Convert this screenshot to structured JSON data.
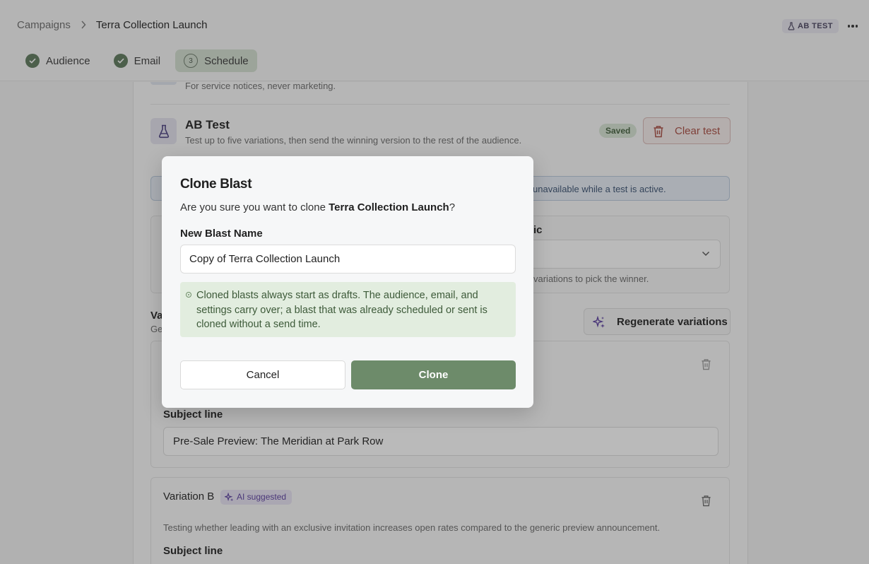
{
  "header": {
    "breadcrumb_root": "Campaigns",
    "breadcrumb_current": "Terra Collection Launch",
    "ab_badge": "AB TEST"
  },
  "steps": [
    {
      "label": "Audience",
      "state": "done"
    },
    {
      "label": "Email",
      "state": "done"
    },
    {
      "label": "Schedule",
      "state": "active",
      "number": "3"
    }
  ],
  "panel": {
    "transactional_desc": "For service notices, never marketing.",
    "ab_title": "AB Test",
    "ab_desc": "Test up to five variations, then send the winning version to the rest of the audience.",
    "saved_badge": "Saved",
    "clear_test": "Clear test",
    "info_banner_partial": "unavailable while a test is active.",
    "metric_label_partial": "ic",
    "metric_help_partial": "variations to pick the winner.",
    "variations_head_partial": "Va",
    "variations_sub_partial": "Ge",
    "regenerate": "Regenerate variations",
    "variation_a": {
      "subject_label": "Subject line",
      "subject_value": "Pre-Sale Preview: The Meridian at Park Row"
    },
    "variation_b": {
      "name": "Variation B",
      "ai_badge": "AI suggested",
      "description": "Testing whether leading with an exclusive invitation increases open rates compared to the generic preview announcement.",
      "subject_label": "Subject line"
    }
  },
  "modal": {
    "title": "Clone Blast",
    "question_prefix": "Are you sure you want to clone ",
    "question_name": "Terra Collection Launch",
    "question_suffix": "?",
    "name_label": "New Blast Name",
    "name_value": "Copy of Terra Collection Launch",
    "note": "Cloned blasts always start as drafts. The audience, email, and settings carry over; a blast that was already scheduled or sent is cloned without a send time.",
    "cancel": "Cancel",
    "clone": "Clone"
  },
  "colors": {
    "accent_green": "#6d8b6a",
    "step_done": "#5e7a5c",
    "danger": "#a84b40",
    "ai_purple": "#5b3ea0"
  }
}
